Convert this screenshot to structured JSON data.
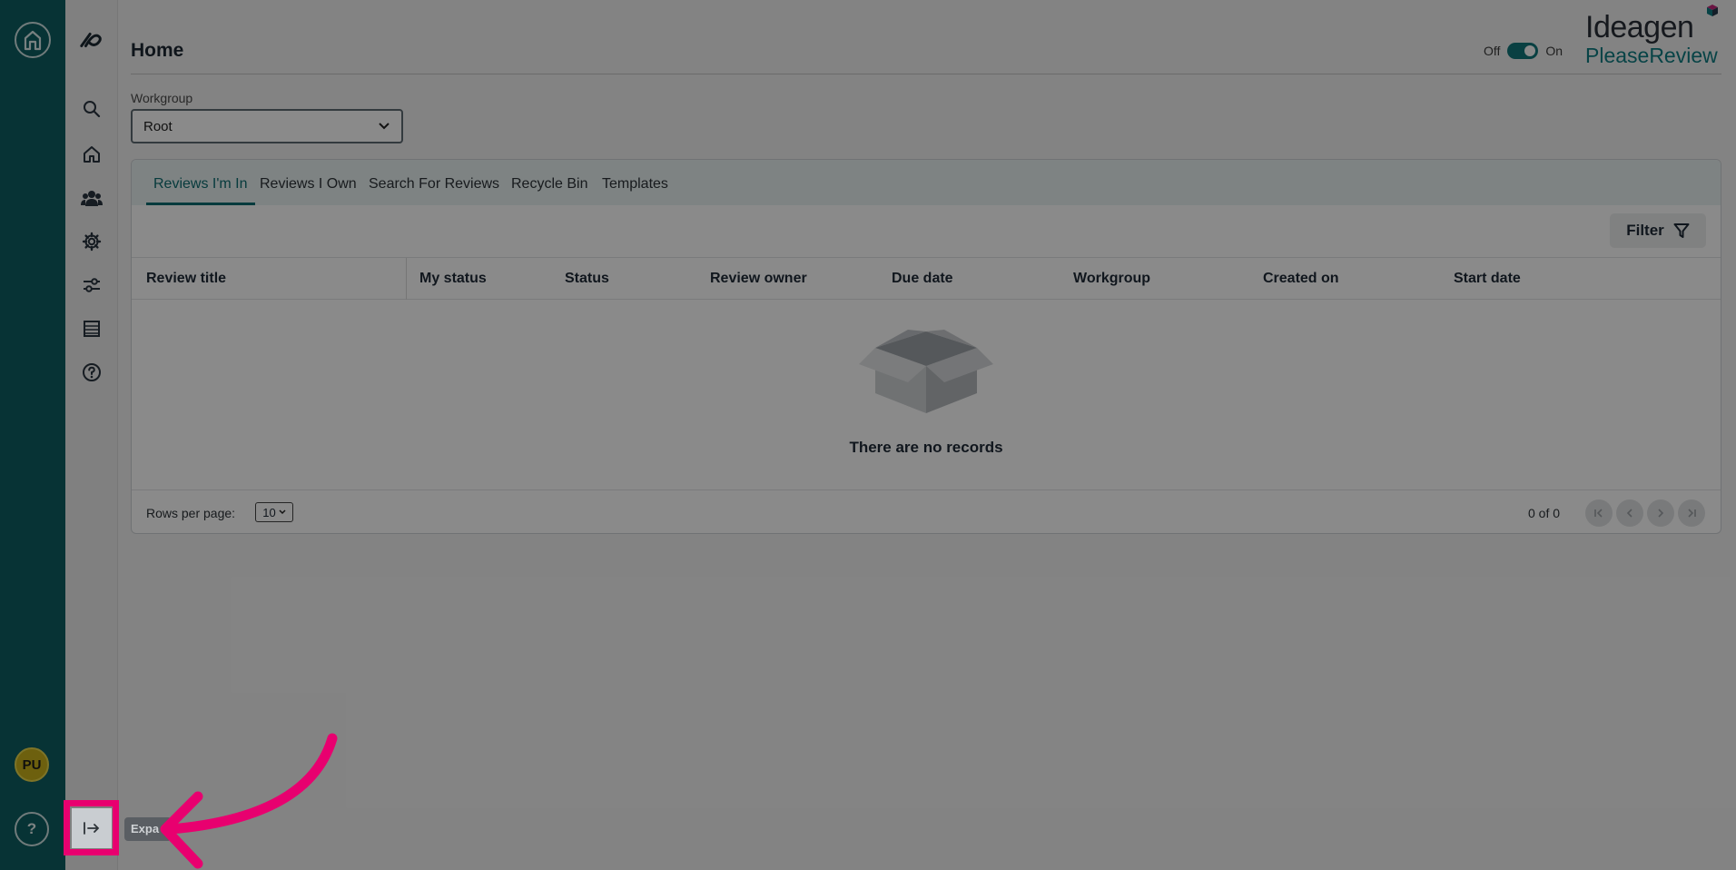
{
  "header": {
    "title": "Home",
    "toggle_off": "Off",
    "toggle_on": "On",
    "logo_top": "Ideagen",
    "logo_bottom": "PleaseReview"
  },
  "rail": {
    "avatar_initials": "PU",
    "help_label": "?"
  },
  "workgroup": {
    "label": "Workgroup",
    "value": "Root"
  },
  "tabs": [
    {
      "label": "Reviews I'm In",
      "active": true
    },
    {
      "label": "Reviews I Own"
    },
    {
      "label": "Search For Reviews"
    },
    {
      "label": "Recycle Bin"
    },
    {
      "label": "Templates"
    }
  ],
  "filter_label": "Filter",
  "columns": [
    "Review title",
    "My status",
    "Status",
    "Review owner",
    "Due date",
    "Workgroup",
    "Created on",
    "Start date"
  ],
  "empty_message": "There are no records",
  "footer": {
    "rows_per_page_label": "Rows per page:",
    "rows_per_page_value": "10",
    "count": "0 of 0"
  },
  "tooltip": "Expa",
  "colors": {
    "rail": "#0e5f62",
    "accent": "#0e6e72",
    "highlight": "#e8006f"
  }
}
